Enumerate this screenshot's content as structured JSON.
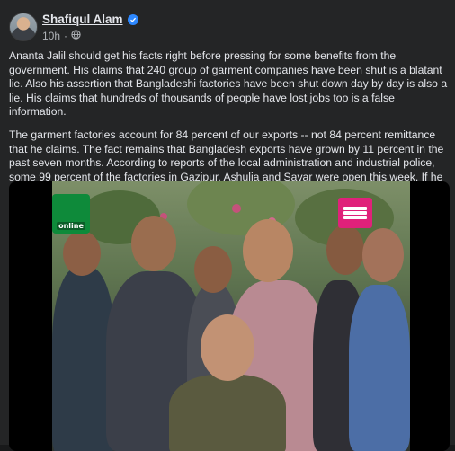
{
  "post": {
    "author": "Shafiqul Alam",
    "time": "10h",
    "separator": "·",
    "paragraphs": [
      "Ananta Jalil should get his facts right before pressing for some benefits from the government. His claims that 240 group of garment companies have been shut is a blatant lie. Also his assertion that Bangladeshi factories have been shut down day by day is also a lie. His claims that hundreds of thousands of people have lost jobs too is a false information.",
      "The garment factories account for 84 percent of our exports -- not 84 percent remittance that he claims. The fact remains that Bangladesh exports have grown by 11 percent in the past seven months. According to reports of the local administration and industrial police, some 99 percent of the factories in Gazipur, Ashulia and Savar were open this week. If he thinks that the government is making false claims, I will humbly request him to provide his data and figures."
    ],
    "media": {
      "left_logo_text": "online"
    }
  },
  "icons": {
    "verified": "verified-badge-icon",
    "audience": "globe-icon"
  }
}
